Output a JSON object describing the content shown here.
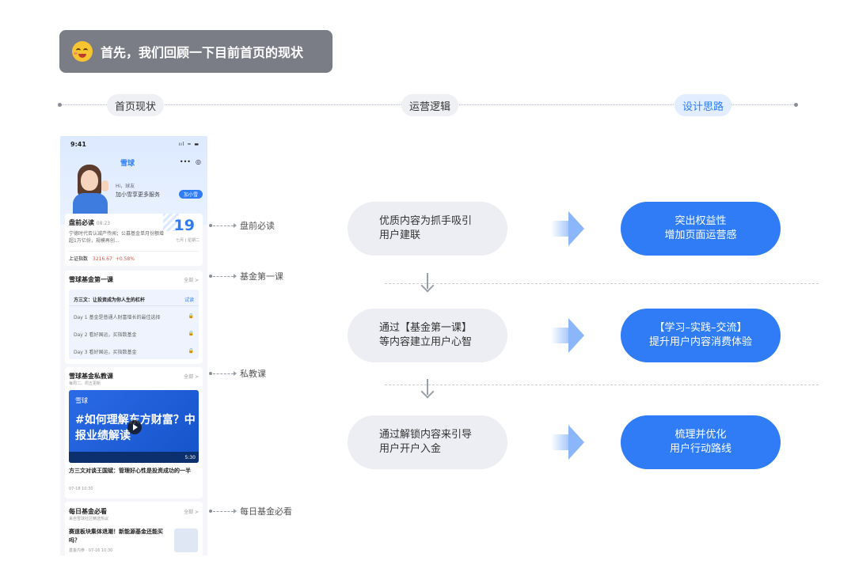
{
  "banner": {
    "title": "首先，我们回顾一下目前首页的现状"
  },
  "timeline": {
    "stages": [
      "首页现状",
      "运营逻辑",
      "设计思路"
    ]
  },
  "phone": {
    "time": "9:41",
    "status": "ııl ≈ ▬",
    "logo": "雪球",
    "capsule_more": "•••",
    "capsule_close": "◎",
    "greeting_hi": "Hi，球友",
    "greeting_text": "加小雪享更多服务",
    "greeting_button": "加小雪",
    "card1": {
      "title": "盘前必读",
      "time": "08:23",
      "text": "宁德时代否认减产传闻；公募基金单月份额增超1万亿份，规模再创...",
      "day": "19",
      "date_info": "七月 | 星期二",
      "index_label": "上证指数",
      "index_value": "3216.67",
      "index_change": "+0.58%"
    },
    "card2": {
      "title": "雪球基金第一课",
      "more": "全部 >",
      "head": "方三文：让投资成为你人生的杠杆",
      "head_action": "试读",
      "lessons": [
        "Day 1  基金是普通人财富增长的最佳选择",
        "Day 2  看好国运，买指数基金",
        "Day 3  看好国运，买指数基金"
      ],
      "lock": "🔒"
    },
    "card3": {
      "title": "雪球基金私教课",
      "subtitle": "每周二、周五更新",
      "more": "全部 >",
      "video_logo": "雪球",
      "video_title": "#如何理解东方财富？中报业绩解读",
      "duration": "5:30",
      "caption": "方三文对谈王国斌：管理好心性是投资成功的一半",
      "caption_time": "07-18 10:30"
    },
    "card4": {
      "title": "每日基金必看",
      "subtitle": "来自雪球社区精选热议",
      "more": "全部 >",
      "text": "赛道板块集体退潮！新能源基金还能买吗？",
      "meta": "基金内参 · 07-16 10:30"
    }
  },
  "side_labels": [
    "盘前必读",
    "基金第一课",
    "私教课",
    "每日基金必看"
  ],
  "flow": [
    {
      "logic": [
        "优质内容为抓手吸引",
        "用户建联"
      ],
      "design": [
        "突出权益性",
        "增加页面运营感"
      ]
    },
    {
      "logic": [
        "通过【基金第一课】",
        "等内容建立用户心智"
      ],
      "design": [
        "【学习–实践–交流】",
        "提升用户内容消费体验"
      ]
    },
    {
      "logic": [
        "通过解锁内容来引导",
        "用户开户入金"
      ],
      "design": [
        "梳理并优化",
        "用户行动路线"
      ]
    }
  ],
  "colors": {
    "accent": "#2f7cf6",
    "banner": "#7b7d86",
    "pill_grey": "#eceef3"
  }
}
